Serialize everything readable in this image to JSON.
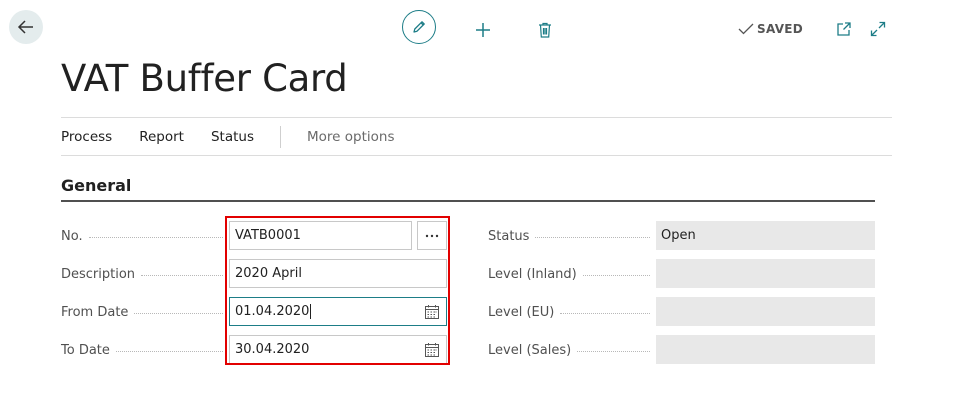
{
  "header": {
    "saved_label": "SAVED"
  },
  "page": {
    "title": "VAT Buffer Card"
  },
  "actions": {
    "items": [
      "Process",
      "Report",
      "Status"
    ],
    "more_label": "More options"
  },
  "section": {
    "title": "General"
  },
  "left_fields": [
    {
      "label": "No.",
      "value": "VATB0001"
    },
    {
      "label": "Description",
      "value": "2020 April"
    },
    {
      "label": "From Date",
      "value": "01.04.2020"
    },
    {
      "label": "To Date",
      "value": "30.04.2020"
    }
  ],
  "right_fields": [
    {
      "label": "Status",
      "value": "Open"
    },
    {
      "label": "Level (Inland)",
      "value": ""
    },
    {
      "label": "Level (EU)",
      "value": ""
    },
    {
      "label": "Level (Sales)",
      "value": ""
    }
  ],
  "icons": {
    "back": "arrow-left-icon",
    "edit": "pencil-icon",
    "new": "plus-icon",
    "delete": "trash-icon",
    "saved": "checkmark-icon",
    "open_new_window": "open-in-new-window-icon",
    "expand": "expand-icon",
    "ellipsis": "ellipsis-icon",
    "calendar": "calendar-icon"
  },
  "colors": {
    "accent": "#1d7d87",
    "highlight_box": "#e20000",
    "readonly_bg": "#e8e8e8",
    "back_button_bg": "#e4eced"
  }
}
